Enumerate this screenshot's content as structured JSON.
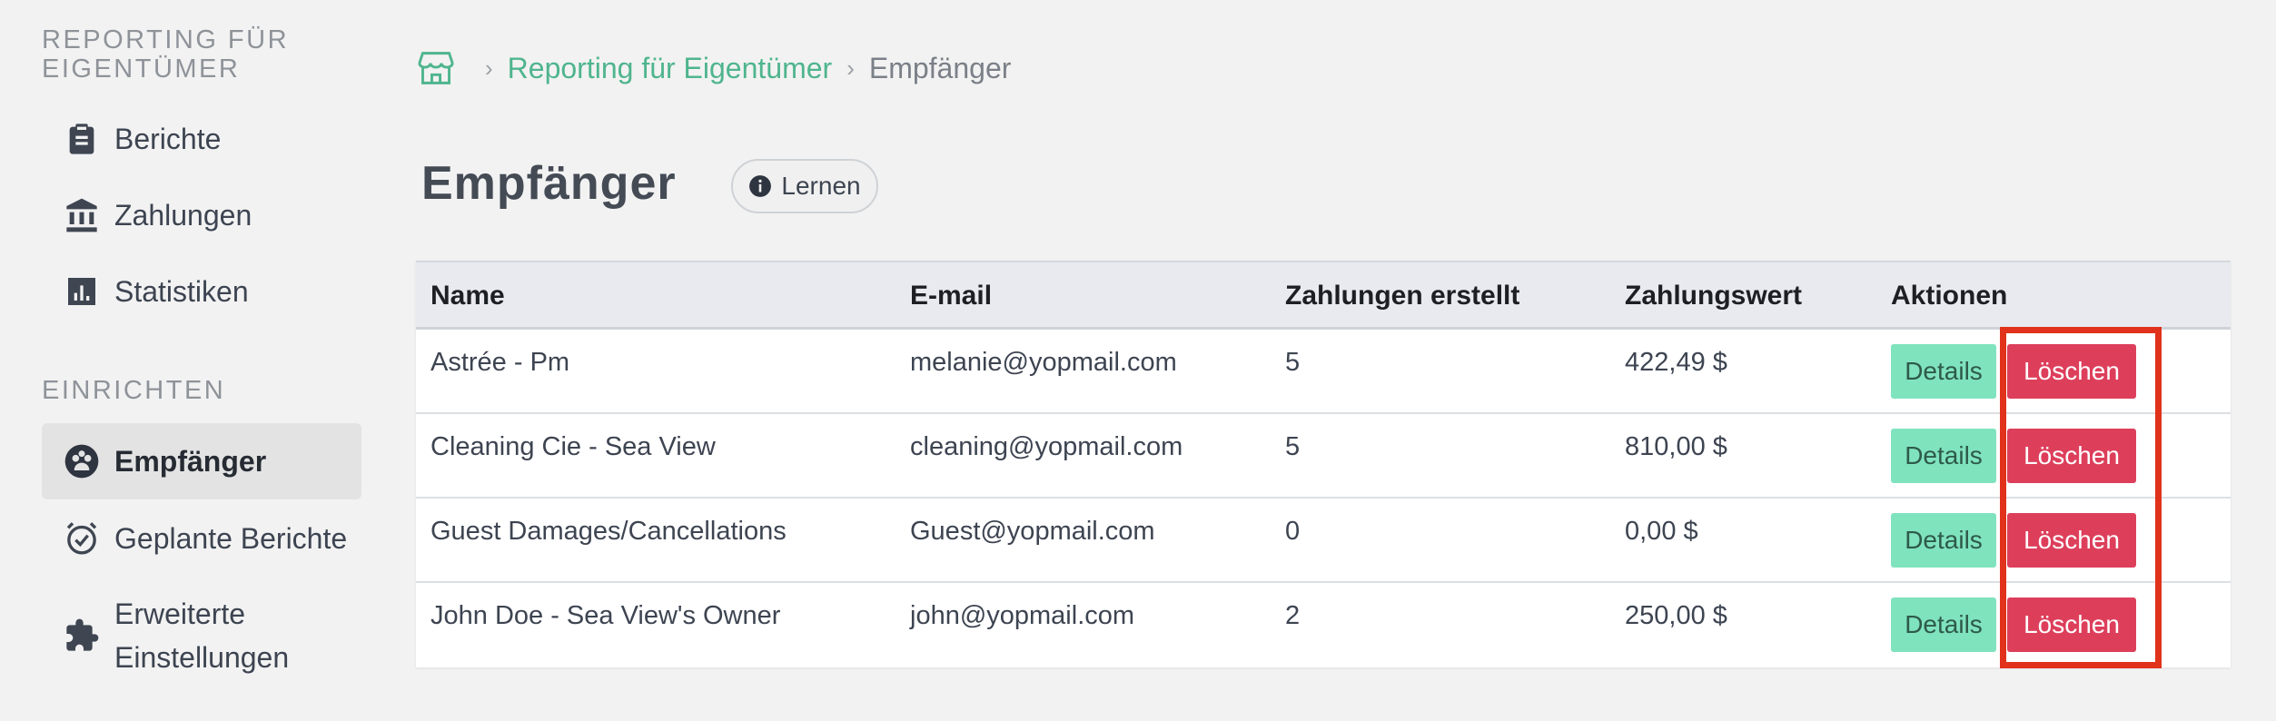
{
  "sidebar": {
    "section_reporting": "REPORTING FÜR EIGENTÜMER",
    "section_setup": "EINRICHTEN",
    "items": [
      {
        "label": "Berichte",
        "icon": "clipboard-icon"
      },
      {
        "label": "Zahlungen",
        "icon": "bank-icon"
      },
      {
        "label": "Statistiken",
        "icon": "bar-chart-icon"
      },
      {
        "label": "Empfänger",
        "icon": "group-icon",
        "active": true
      },
      {
        "label": "Geplante Berichte",
        "icon": "alarm-clock-icon"
      },
      {
        "label_line1": "Erweiterte",
        "label_line2": "Einstellungen",
        "icon": "puzzle-icon"
      }
    ]
  },
  "breadcrumb": {
    "home_icon": "home-icon",
    "link": "Reporting für Eigentümer",
    "current": "Empfänger"
  },
  "page": {
    "title": "Empfänger",
    "learn_label": "Lernen"
  },
  "table": {
    "headers": [
      "Name",
      "E-mail",
      "Zahlungen erstellt",
      "Zahlungswert",
      "Aktionen"
    ],
    "rows": [
      {
        "name": "Astrée - Pm",
        "email": "melanie@yopmail.com",
        "count": "5",
        "value": "422,49 $"
      },
      {
        "name": "Cleaning Cie - Sea View",
        "email": "cleaning@yopmail.com",
        "count": "5",
        "value": "810,00 $"
      },
      {
        "name": "Guest Damages/Cancellations",
        "email": "Guest@yopmail.com",
        "count": "0",
        "value": "0,00 $"
      },
      {
        "name": "John Doe - Sea View's Owner",
        "email": "john@yopmail.com",
        "count": "2",
        "value": "250,00 $"
      }
    ],
    "details_label": "Details",
    "delete_label": "Löschen"
  },
  "colors": {
    "accent_green": "#4fb58e",
    "details_button": "#7fe3be",
    "delete_button": "#dd3f5b",
    "highlight": "#e1321b"
  }
}
